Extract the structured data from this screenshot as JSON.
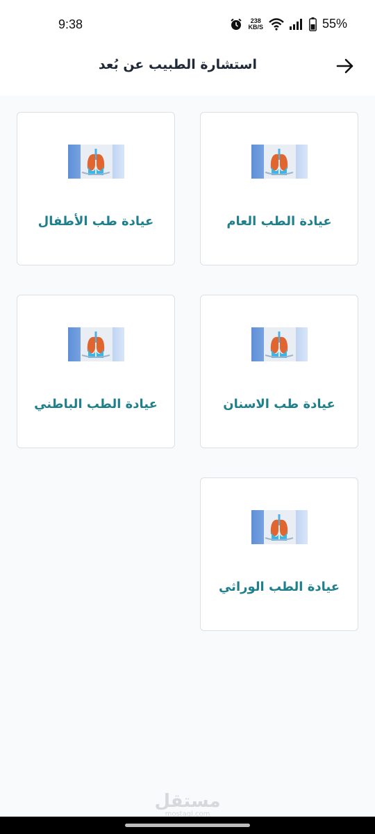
{
  "status_bar": {
    "time": "9:38",
    "net_speed_value": "238",
    "net_speed_unit": "KB/S",
    "battery_percent": "55%"
  },
  "header": {
    "title": "استشارة الطبيب عن بُعد",
    "back_icon": "arrow-right-icon"
  },
  "clinics": [
    {
      "label": "عيادة الطب العام",
      "image": "lungs-doctor-image"
    },
    {
      "label": "عيادة طب الأطفال",
      "image": "lungs-doctor-image"
    },
    {
      "label": "عيادة طب الاسنان",
      "image": "lungs-doctor-image"
    },
    {
      "label": "عيادة الطب الباطني",
      "image": "lungs-doctor-image"
    },
    {
      "label": "عيادة الطب الوراثي",
      "image": "lungs-doctor-image"
    }
  ],
  "watermark": {
    "arabic": "مستقل",
    "latin": "mostaql.com"
  },
  "colors": {
    "accent": "#1f7f8a",
    "background": "#f8fafc",
    "card_border": "#dcdfe4"
  }
}
